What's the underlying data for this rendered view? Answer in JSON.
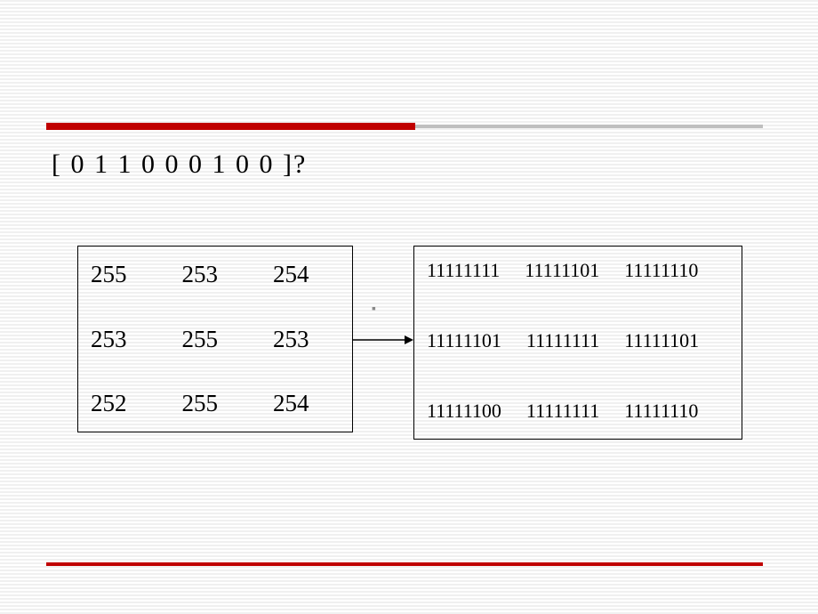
{
  "slide": {
    "question": "[ 0 1 1 0 0 0 1 0 0 ]?",
    "decimal_matrix": {
      "rows": [
        {
          "c0": "255",
          "c1": "253",
          "c2": "254"
        },
        {
          "c0": "253",
          "c1": "255",
          "c2": "253"
        },
        {
          "c0": "252",
          "c1": "255",
          "c2": "254"
        }
      ]
    },
    "binary_matrix": {
      "rows": [
        {
          "c0": "11111111",
          "c1": "11111101",
          "c2": "11111110"
        },
        {
          "c0": "11111101",
          "c1": "11111111",
          "c2": "11111101"
        },
        {
          "c0": "11111100",
          "c1": "11111111",
          "c2": "11111110"
        }
      ]
    },
    "colors": {
      "rule_red": "#c00000",
      "rule_gray": "#bfbfbf"
    }
  }
}
